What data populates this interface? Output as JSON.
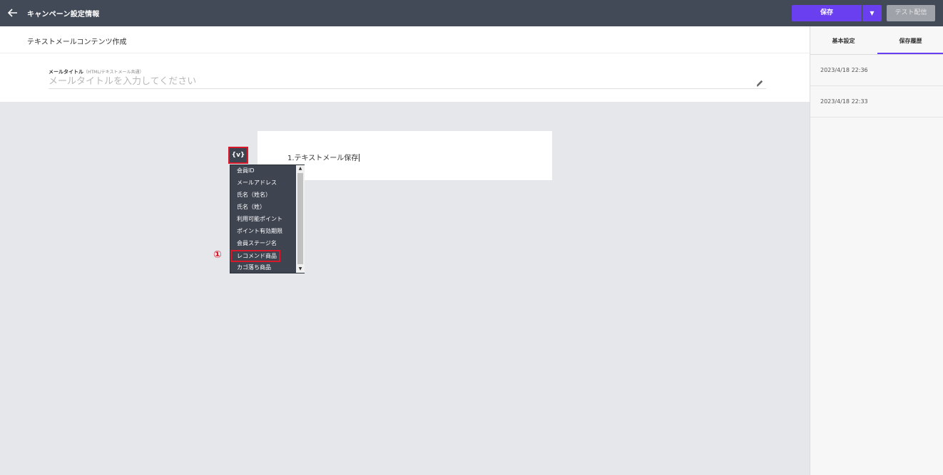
{
  "header": {
    "back_icon": "arrow-left-icon",
    "title": "キャンペーン設定情報",
    "save_label": "保存",
    "save_dropdown_icon": "caret-down-icon",
    "test_label": "テスト配信"
  },
  "content": {
    "section_title": "テキストメールコンテンツ作成",
    "mail_title_label": "メールタイトル",
    "mail_title_sublabel": "（HTML/テキストメール共通）",
    "mail_title_placeholder": "メールタイトルを入力してください",
    "edit_icon": "pencil-icon"
  },
  "editor": {
    "text": "1.テキストメール保存"
  },
  "variable_button": {
    "label": "{v}"
  },
  "variable_menu": {
    "items": [
      "会員ID",
      "メールアドレス",
      "氏名（姓名）",
      "氏名（姓）",
      "利用可能ポイント",
      "ポイント有効期限",
      "会員ステージ名",
      "レコメンド商品",
      "カゴ落ち商品"
    ],
    "highlighted_index": 7
  },
  "annotation": {
    "marker": "①",
    "color": "#d9192a"
  },
  "sidebar": {
    "tabs": [
      "基本設定",
      "保存履歴"
    ],
    "active_tab": 1,
    "history": [
      "2023/4/18 22:36",
      "2023/4/18 22:33"
    ]
  },
  "colors": {
    "accent": "#6a3ff0",
    "topbar": "#434a57",
    "highlight": "#d9192a"
  }
}
